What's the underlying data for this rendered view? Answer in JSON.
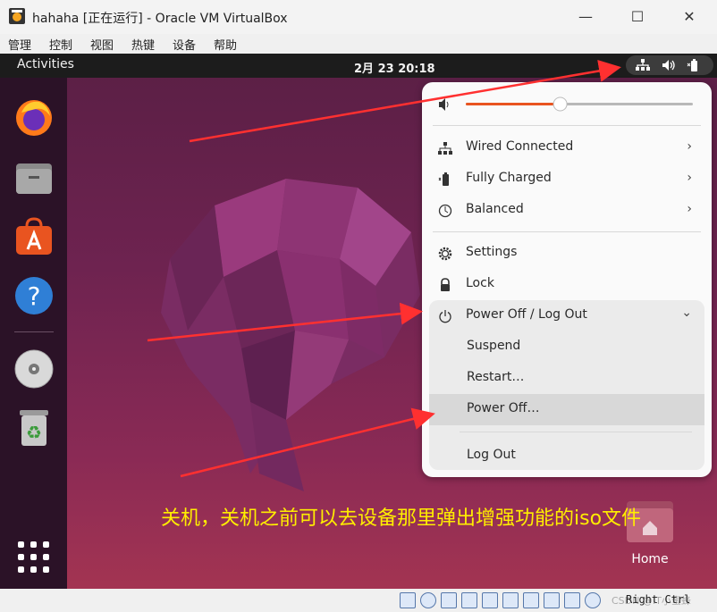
{
  "window": {
    "title": "hahaha [正在运行] - Oracle VM VirtualBox",
    "minimize_glyph": "—",
    "maximize_glyph": "☐",
    "close_glyph": "✕"
  },
  "menubar": {
    "items": [
      "管理",
      "控制",
      "视图",
      "热键",
      "设备",
      "帮助"
    ]
  },
  "vm": {
    "topbar": {
      "activities": "Activities",
      "clock": "2月 23  20:18"
    },
    "dock": {
      "items": [
        "firefox-icon",
        "files-icon",
        "app-center-icon",
        "help-icon",
        "cd-drive-icon",
        "trash-icon"
      ],
      "show_apps": "show-applications-icon"
    },
    "quick_settings": {
      "volume_level": 0.4,
      "rows": [
        {
          "label": "Wired Connected",
          "icon": "network-icon"
        },
        {
          "label": "Fully Charged",
          "icon": "battery-icon"
        },
        {
          "label": "Balanced",
          "icon": "power-mode-icon"
        }
      ],
      "settings_label": "Settings",
      "lock_label": "Lock",
      "power_label": "Power Off / Log Out",
      "submenu": [
        "Suspend",
        "Restart…",
        "Power Off…",
        "Log Out"
      ]
    },
    "desktop": {
      "home_label": "Home"
    },
    "annotation": "关机，关机之前可以去设备那里弹出增强功能的iso文件"
  },
  "statusbar": {
    "right_ctrl": "Right Ctrl",
    "watermark": "CSDN @IT小蜜蜂"
  },
  "colors": {
    "accent": "#e95420",
    "annotation": "#ffee00",
    "arrow": "#ff3030"
  }
}
